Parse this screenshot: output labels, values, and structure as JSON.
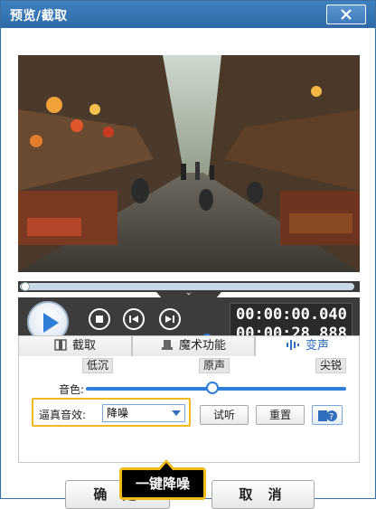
{
  "window": {
    "title": "预览/截取"
  },
  "player": {
    "time_current": "00:00:00.040",
    "time_total": "00:00:28.888",
    "progress_fraction": 0.0,
    "volume_fraction": 0.9
  },
  "tabs": [
    {
      "label": "截取",
      "icon": "film-cut-icon"
    },
    {
      "label": "魔术功能",
      "icon": "magic-hat-icon"
    },
    {
      "label": "变声",
      "icon": "sound-wave-icon"
    }
  ],
  "voice": {
    "pitch_low": "低沉",
    "pitch_mid": "原声",
    "pitch_high": "尖锐",
    "pitch_label": "音色:",
    "pitch_fraction": 0.5,
    "effect_label": "逼真音效:",
    "effect_value": "降噪",
    "listen_label": "试听",
    "reset_label": "重置"
  },
  "footer": {
    "confirm_label": "确 定",
    "cancel_label": "取 消"
  },
  "callout": {
    "text": "一键降噪"
  },
  "colors": {
    "accent": "#2f7ed8",
    "highlight": "#f2b91c",
    "titlebar": "#3576b7"
  }
}
